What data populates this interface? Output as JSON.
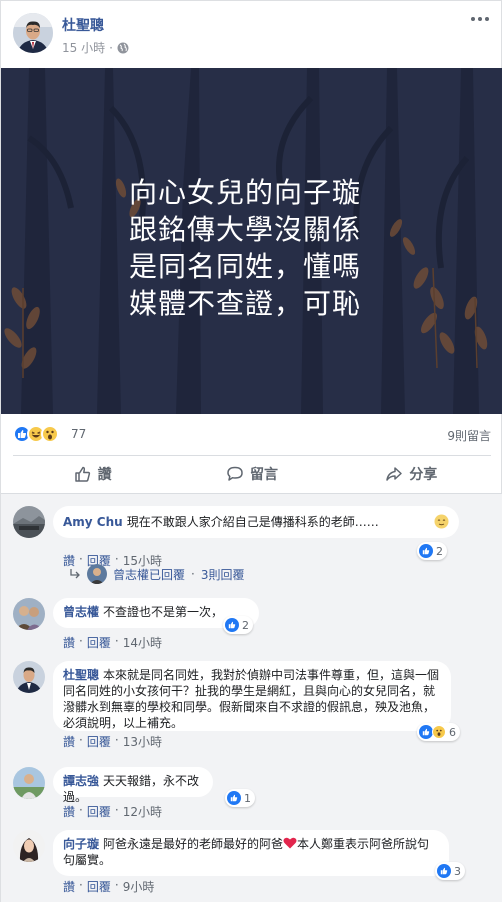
{
  "post": {
    "author": "杜聖聰",
    "time": "15 小時",
    "dot": "·",
    "image_text": [
      "向心女兒的向子璇",
      "跟銘傳大學沒關係",
      "是同名同姓，懂嗎",
      "媒體不查證，可恥"
    ]
  },
  "reactions": {
    "count": "77",
    "comments": "9則留言"
  },
  "actions": {
    "like": "讚",
    "comment": "留言",
    "share": "分享"
  },
  "comments": [
    {
      "name": "Amy Chu",
      "text": "現在不敢跟人家介紹自己是傳播科系的老師……",
      "like": "讚",
      "reply": "回覆",
      "dot": "·",
      "time": "15小時",
      "reactions": "2"
    },
    {
      "name": "曾志權",
      "text": "不查證也不是第一次，",
      "like": "讚",
      "reply": "回覆",
      "dot": "·",
      "time": "14小時",
      "reactions": "2"
    },
    {
      "name": "杜聖聰",
      "text": "本來就是同名同姓，我對於偵辦中司法事件尊重，但，這與一個同名同姓的小女孩何干？扯我的學生是網紅，且與向心的女兒同名，就潑髒水到無辜的學校和同學。假新聞來自不求證的假訊息，殃及池魚，必須說明，以上補充。",
      "like": "讚",
      "reply": "回覆",
      "dot": "·",
      "time": "13小時",
      "reactions": "6"
    },
    {
      "name": "譚志強",
      "text": "天天報錯，永不改過。",
      "like": "讚",
      "reply": "回覆",
      "dot": "·",
      "time": "12小時",
      "reactions": "1"
    },
    {
      "name": "向子璇",
      "text_before": "阿爸永遠是最好的老師最好的阿爸",
      "text_after": "本人鄭重表示阿爸所說句句屬實。",
      "like": "讚",
      "reply": "回覆",
      "dot": "·",
      "time": "9小時",
      "reactions": "3"
    }
  ],
  "reply_summary": {
    "text": "曾志權已回覆",
    "dot": "·",
    "count": "3則回覆"
  },
  "colors": {
    "link": "#385898",
    "like_blue": "#2078f4",
    "bg": "#f2f3f5",
    "image_bg": "#262d45",
    "heart": "#e2264d"
  }
}
